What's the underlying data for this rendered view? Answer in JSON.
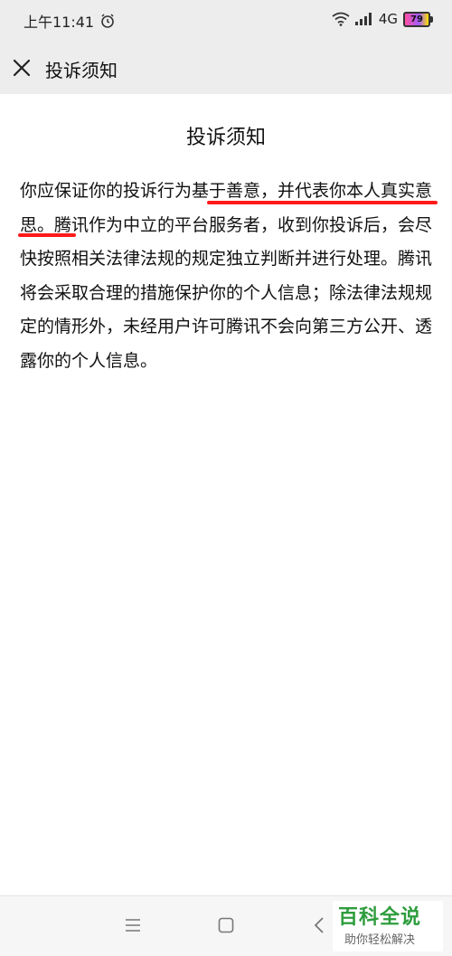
{
  "status_bar": {
    "time": "上午11:41",
    "network": "4G",
    "battery": "79"
  },
  "header": {
    "title": "投诉须知"
  },
  "main": {
    "title": "投诉须知",
    "paragraph": "你应保证你的投诉行为基于善意，并代表你本人真实意思。腾讯作为中立的平台服务者，收到你投诉后，会尽快按照相关法律法规的规定独立判断并进行处理。腾讯将会采取合理的措施保护你的个人信息；除法律法规规定的情形外，未经用户许可腾讯不会向第三方公开、透露你的个人信息。"
  },
  "watermark": {
    "title": "百科全说",
    "subtitle": "助你轻松解决"
  },
  "colors": {
    "bar_bg": "#ededed",
    "underline": "#ff1a1a",
    "watermark_green": "#2e9d3d"
  }
}
